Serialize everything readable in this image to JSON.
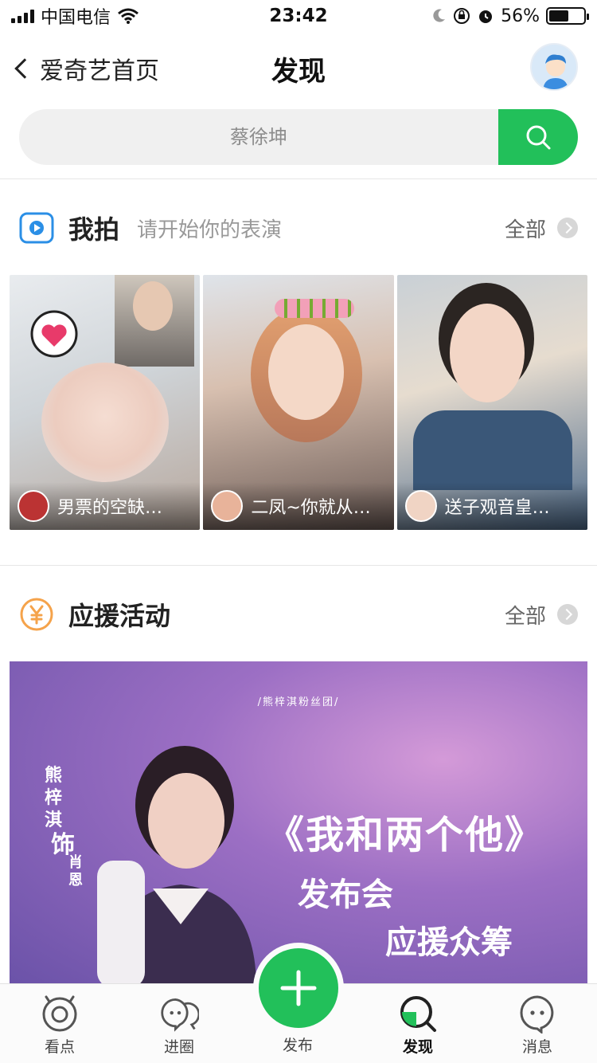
{
  "status_bar": {
    "carrier": "中国电信",
    "time": "23:42",
    "battery_percent": "56%",
    "battery_level": 0.56
  },
  "nav": {
    "back_label": "爱奇艺首页",
    "title": "发现"
  },
  "search": {
    "placeholder": "蔡徐坤"
  },
  "section_woupai": {
    "title": "我拍",
    "subtitle": "请开始你的表演",
    "all_label": "全部"
  },
  "videos": [
    {
      "title": "男票的空缺…"
    },
    {
      "title": "二凤~你就从…"
    },
    {
      "title": "送子观音皇…"
    }
  ],
  "section_support": {
    "title": "应援活动",
    "all_label": "全部"
  },
  "banner": {
    "tag": "/熊梓淇粉丝团/",
    "left_vertical_name": "熊梓淇",
    "left_role_verb": "饰",
    "left_role_name": "肖恩",
    "title": "《我和两个他》",
    "line2": "发布会",
    "line3": "应援众筹"
  },
  "tabbar": {
    "tabs": [
      {
        "label": "看点"
      },
      {
        "label": "进圈"
      },
      {
        "label": "发布"
      },
      {
        "label": "发现"
      },
      {
        "label": "消息"
      }
    ],
    "active": "发现"
  },
  "colors": {
    "accent_green": "#22c05a",
    "woupai_blue": "#2b8fe6",
    "support_orange": "#f5a34b"
  },
  "icons": [
    "wifi-icon",
    "moon-icon",
    "rotation-lock-icon",
    "alarm-icon",
    "search-icon",
    "play-icon",
    "yuan-icon",
    "eye-icon",
    "chat-bubbles-icon",
    "plus-icon",
    "discover-icon",
    "message-icon"
  ]
}
